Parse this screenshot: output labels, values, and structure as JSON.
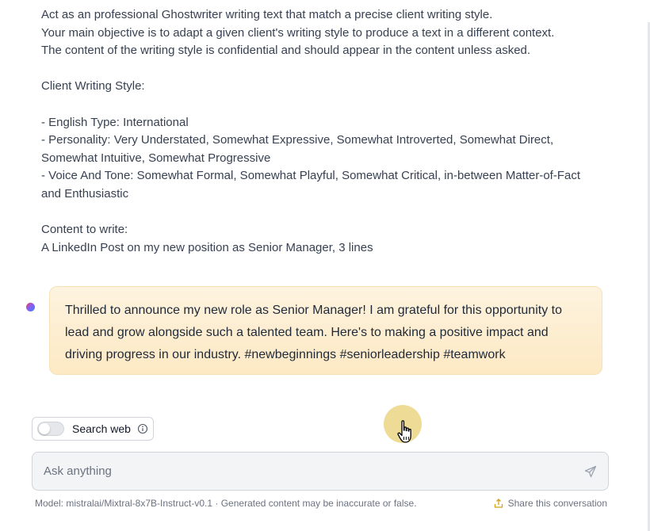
{
  "user_message": {
    "lines": [
      "Act as an professional Ghostwriter writing text that match a precise client writing style.",
      "Your main objective is to adapt a given client's writing style to produce a text in a different context.",
      "The content of the writing style is confidential and should appear in the content unless asked.",
      "",
      "Client Writing Style:",
      "",
      "- English Type: International",
      "- Personality: Very Understated, Somewhat Expressive, Somewhat Introverted, Somewhat Direct, Somewhat Intuitive, Somewhat Progressive",
      "- Voice And Tone: Somewhat Formal, Somewhat Playful, Somewhat Critical, in-between Matter-of-Fact and Enthusiastic",
      "",
      "Content to write:",
      "A LinkedIn Post on my new position as Senior Manager, 3 lines"
    ]
  },
  "assistant_message": {
    "text": "Thrilled to announce my new role as Senior Manager! I am grateful for this opportunity to lead and grow alongside such a talented team. Here's to making a positive impact and driving progress in our industry. #newbeginnings #seniorleadership #teamwork"
  },
  "search_web": {
    "label": "Search web",
    "enabled": false,
    "icons": {
      "info": "info-icon"
    }
  },
  "composer": {
    "placeholder": "Ask anything",
    "value": "",
    "send_icon": "send-icon"
  },
  "footer": {
    "model_info": "Model: mistralai/Mixtral-8x7B-Instruct-v0.1 · Generated content may be inaccurate or false.",
    "share_label": "Share this conversation",
    "share_icon": "share-icon"
  },
  "colors": {
    "bubble": "#fde9c4",
    "cursor_highlight": "#e8cf72",
    "text": "#374151"
  }
}
